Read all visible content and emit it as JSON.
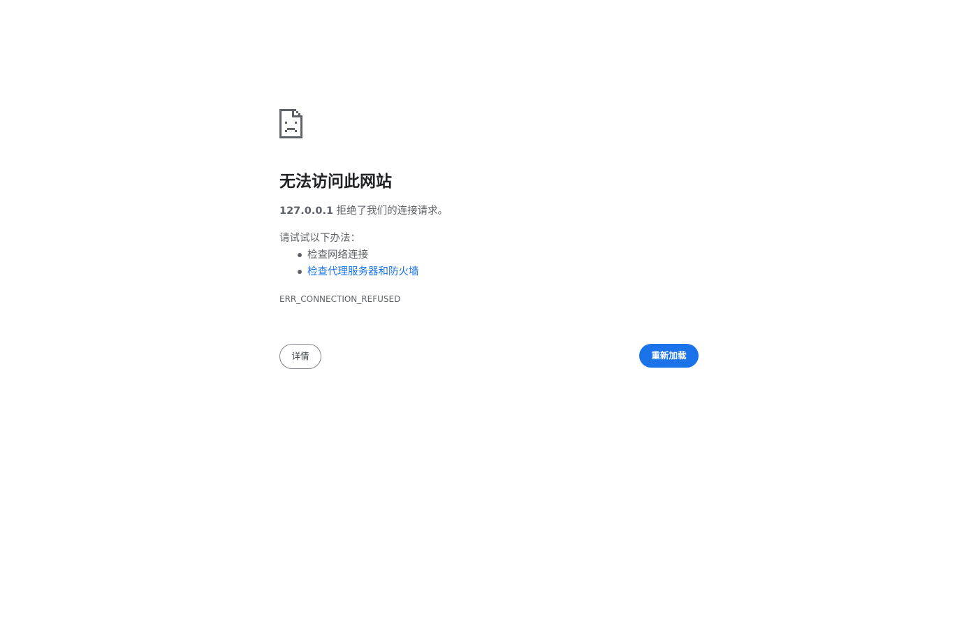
{
  "error_page": {
    "icon": "sad-page-icon",
    "title": "无法访问此网站",
    "host": "127.0.0.1",
    "summary_suffix": " 拒绝了我们的连接请求。",
    "suggestions_heading": "请试试以下办法：",
    "suggestions": [
      {
        "label": "检查网络连接",
        "is_link": false
      },
      {
        "label": "检查代理服务器和防火墙",
        "is_link": true
      }
    ],
    "error_code": "ERR_CONNECTION_REFUSED",
    "details_button": "详情",
    "reload_button": "重新加载"
  },
  "colors": {
    "text_primary": "#202124",
    "text_secondary": "#5f6368",
    "link": "#1a73e8",
    "primary_button": "#1a73e8"
  }
}
